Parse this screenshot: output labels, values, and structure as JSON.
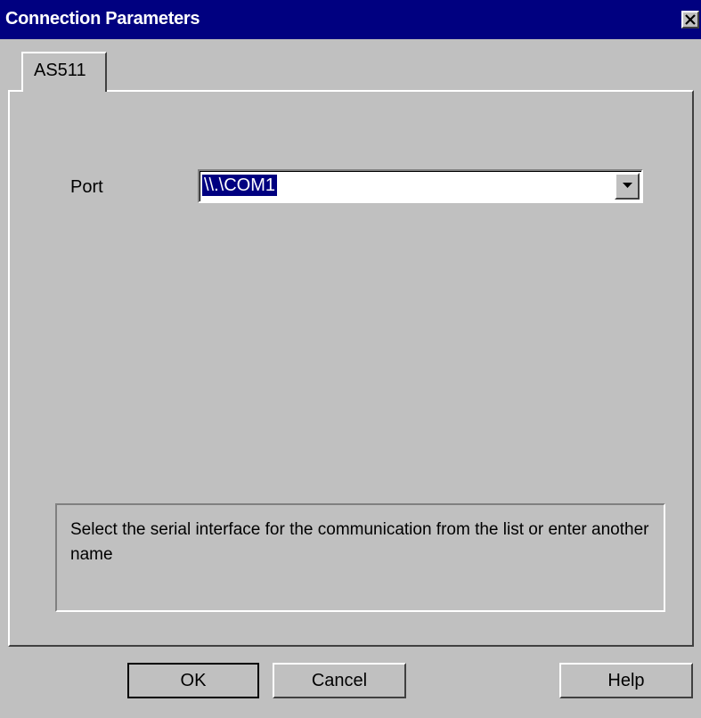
{
  "window": {
    "title": "Connection Parameters",
    "close_icon": "close-icon"
  },
  "tabs": [
    {
      "label": "AS511",
      "selected": true
    }
  ],
  "port": {
    "label": "Port",
    "value": "\\\\.\\COM1",
    "dropdown_icon": "chevron-down-icon"
  },
  "help_text": "Select the serial interface for the communication from the list or enter another name",
  "buttons": {
    "ok": "OK",
    "cancel": "Cancel",
    "help": "Help"
  },
  "colors": {
    "titlebar": "#000080",
    "face": "#c0c0c0",
    "selection": "#000080"
  }
}
